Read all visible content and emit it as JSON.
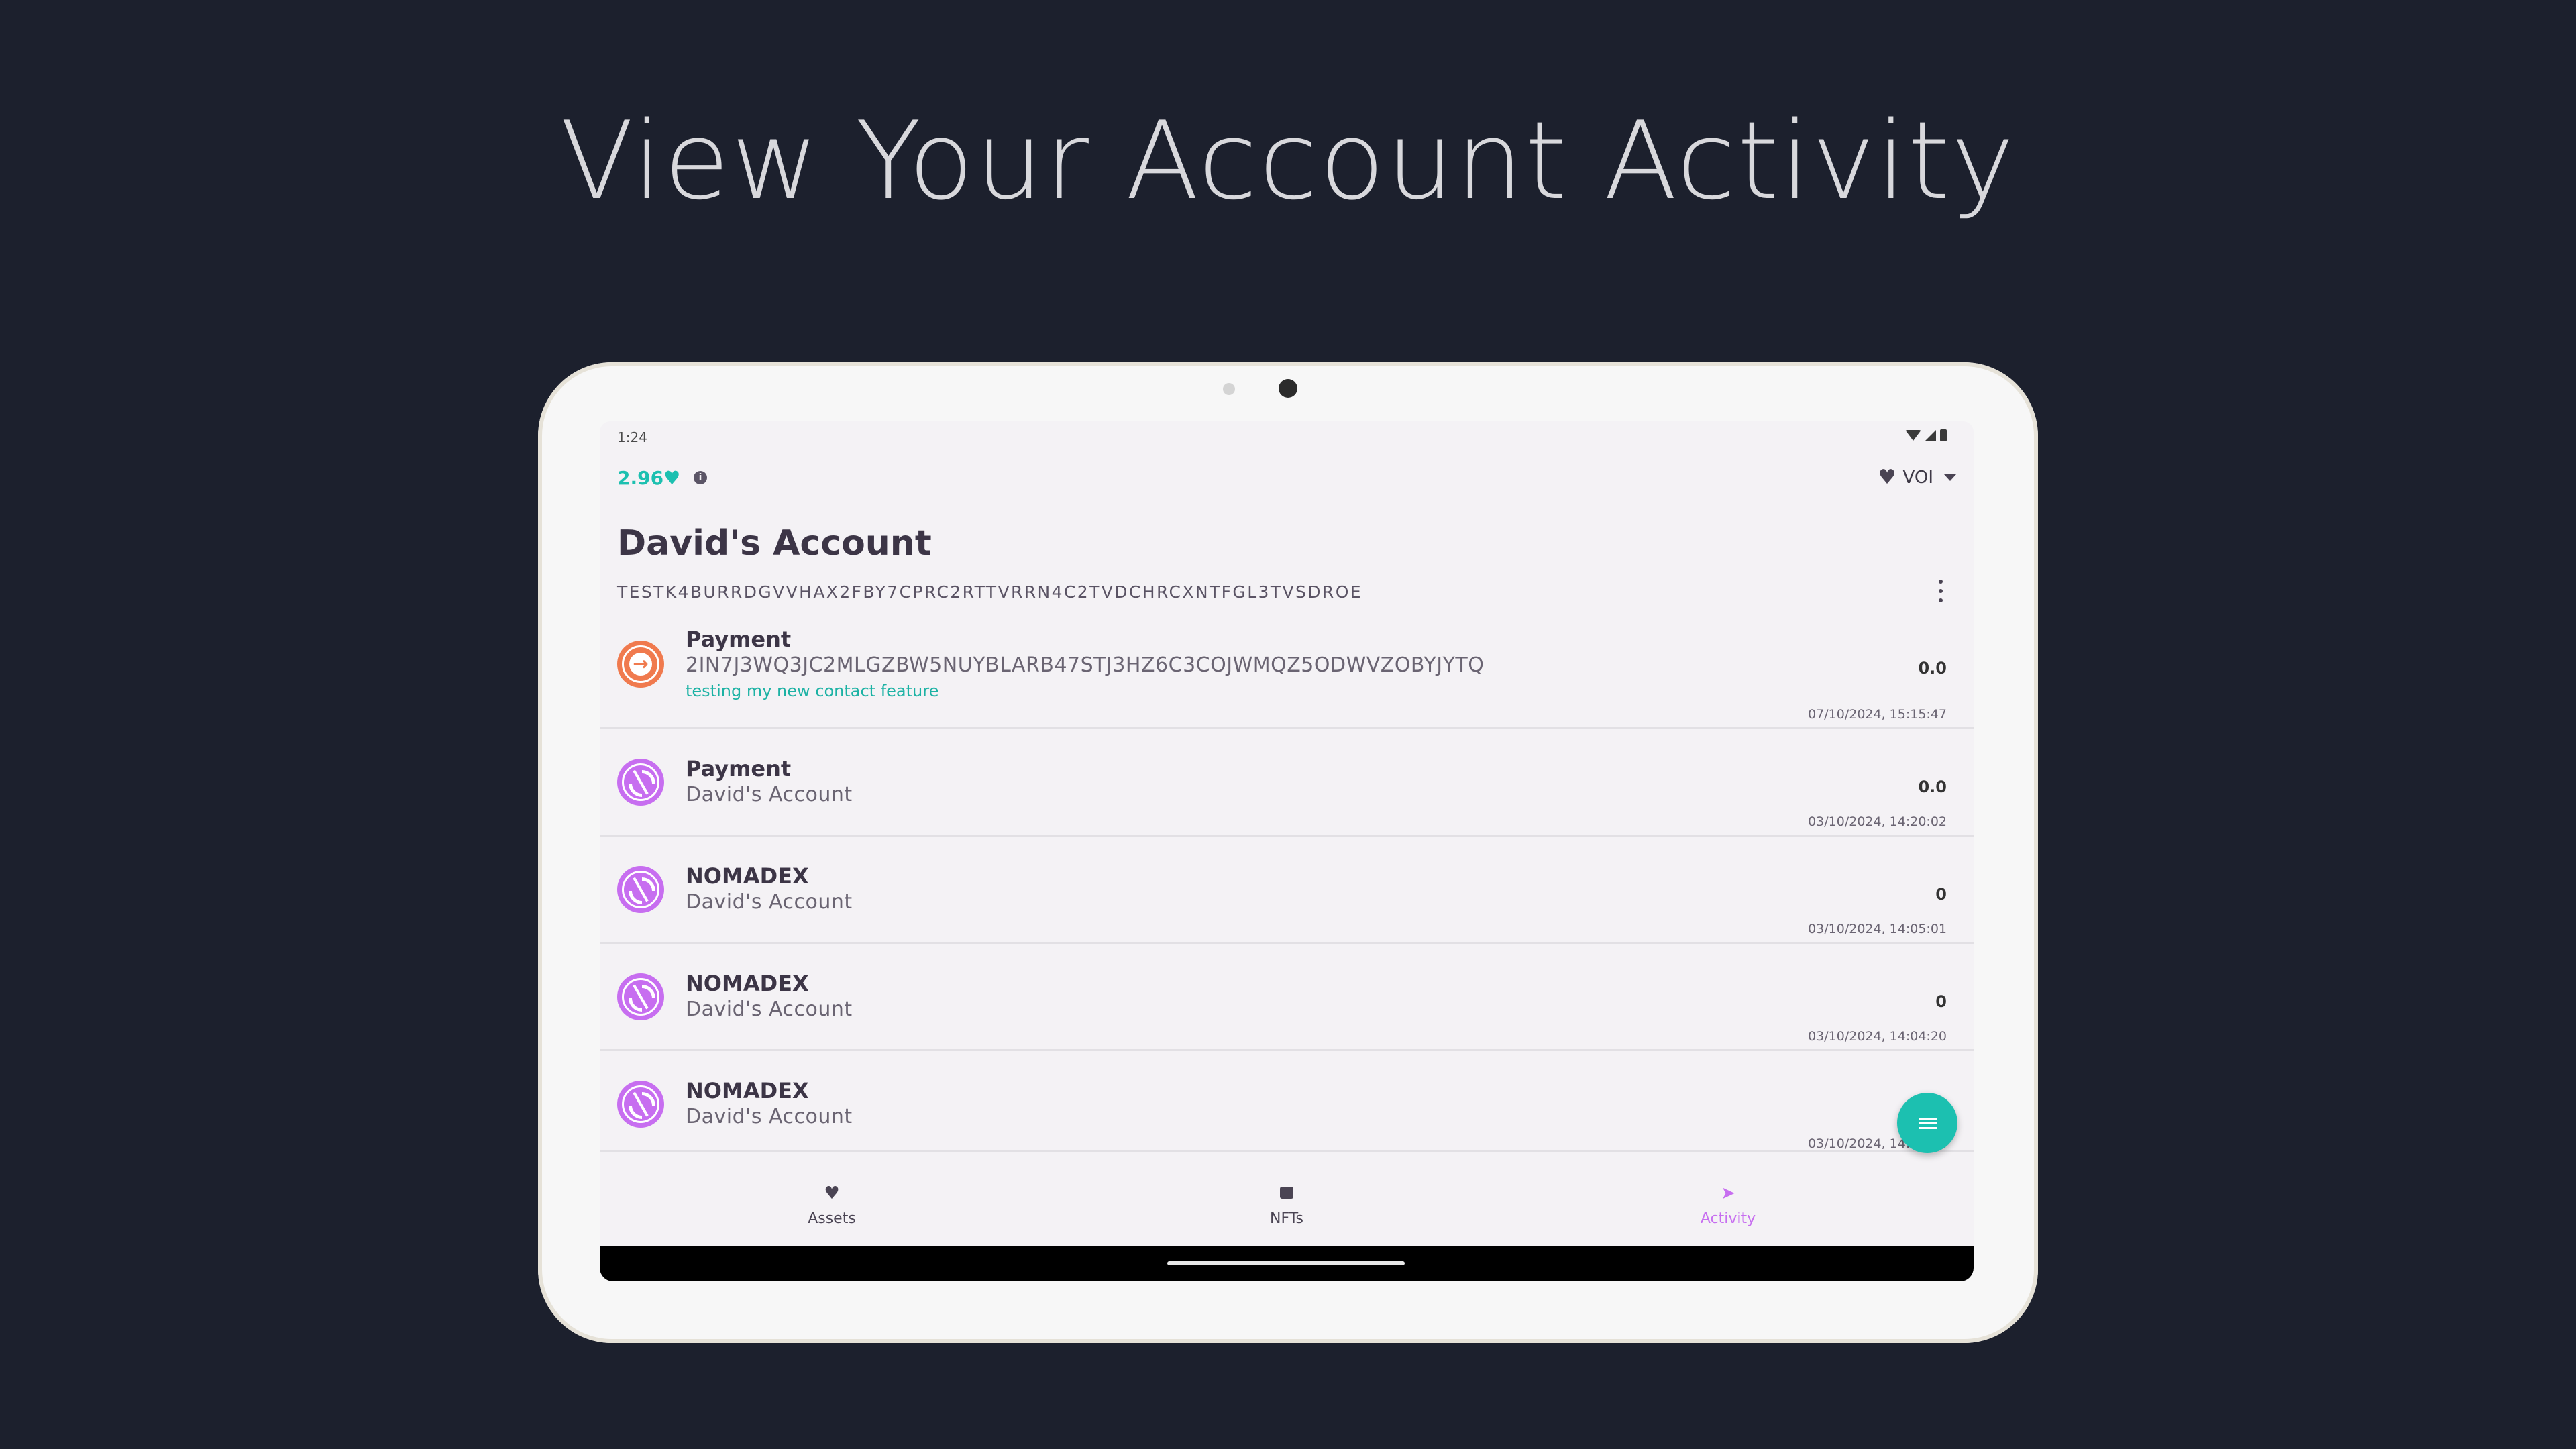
{
  "headline": "View Your Account Activity",
  "status_bar": {
    "time": "1:24"
  },
  "wallet": {
    "balance": "2.96",
    "currency_glyph": "♥",
    "network_label": "VOI"
  },
  "account": {
    "name": "David's Account",
    "address": "TESTK4BURRDGVVHAX2FBY7CPRC2RTTVRRN4C2TVDCHRCXNTFGL3TVSDROE"
  },
  "transactions": [
    {
      "type": "Payment",
      "icon": "payment-out-icon",
      "counterparty": "2IN7J3WQ3JC2MLGZBW5NUYBLARB47STJ3HZ6C3COJWMQZ5ODWVZOBYJYTQ",
      "note": "testing my new contact feature",
      "amount": "0.0",
      "date": "07/10/2024, 15:15:47"
    },
    {
      "type": "Payment",
      "icon": "self-transfer-icon",
      "counterparty": "David's Account",
      "note": "",
      "amount": "0.0",
      "date": "03/10/2024, 14:20:02"
    },
    {
      "type": "NOMADEX",
      "icon": "self-transfer-icon",
      "counterparty": "David's Account",
      "note": "",
      "amount": "0",
      "date": "03/10/2024, 14:05:01"
    },
    {
      "type": "NOMADEX",
      "icon": "self-transfer-icon",
      "counterparty": "David's Account",
      "note": "",
      "amount": "0",
      "date": "03/10/2024, 14:04:20"
    },
    {
      "type": "NOMADEX",
      "icon": "self-transfer-icon",
      "counterparty": "David's Account",
      "note": "",
      "amount": "",
      "date": "03/10/2024, 14:03:22"
    }
  ],
  "bottom_nav": [
    {
      "label": "Assets",
      "icon": "heart-icon",
      "active": false
    },
    {
      "label": "NFTs",
      "icon": "image-icon",
      "active": false
    },
    {
      "label": "Activity",
      "icon": "send-icon",
      "active": true
    }
  ],
  "colors": {
    "background": "#1c202d",
    "accent_teal": "#1cc0b0",
    "accent_purple": "#c76ef0",
    "payment_orange": "#f07a4e"
  }
}
